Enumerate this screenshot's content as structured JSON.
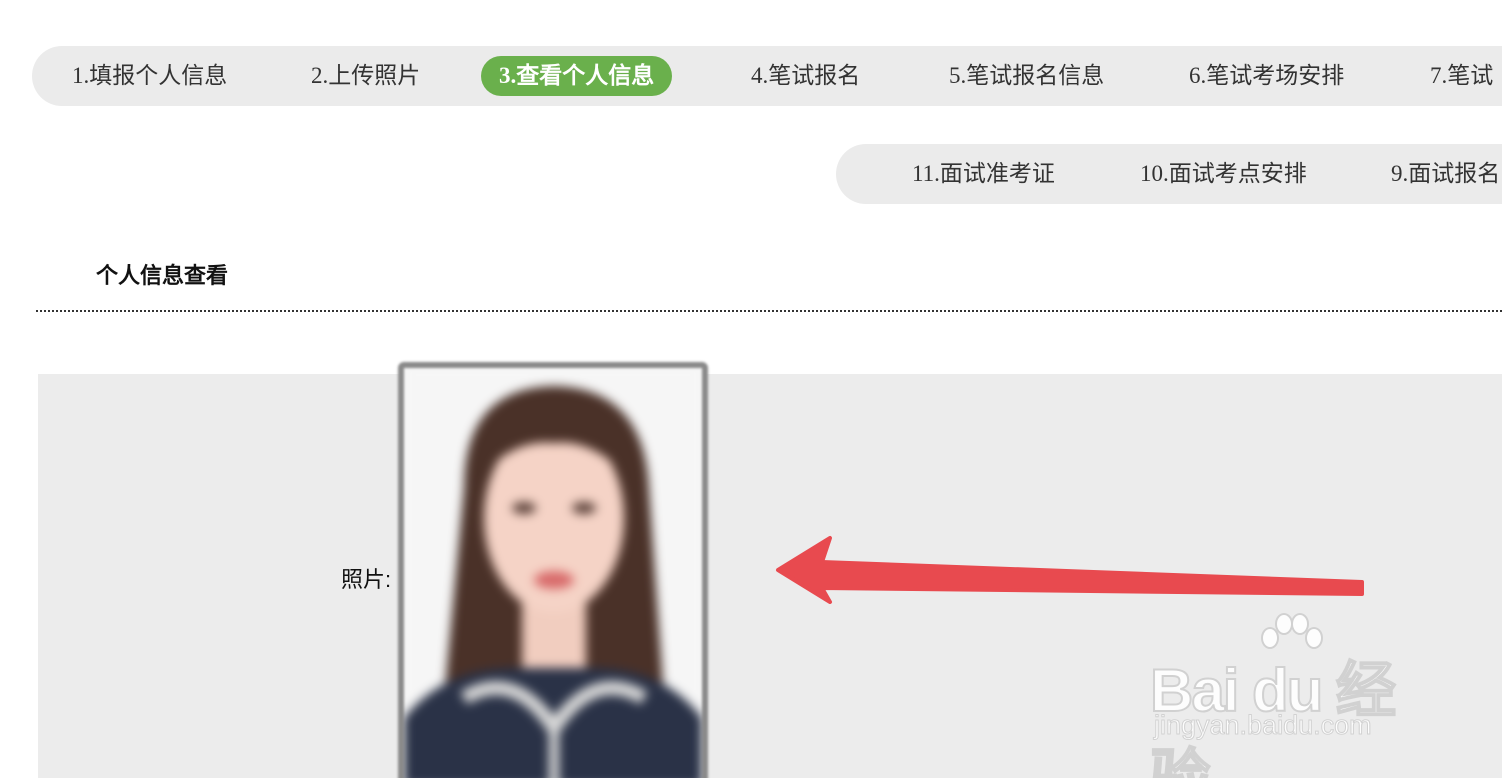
{
  "steps_row1": [
    {
      "label": "1.填报个人信息",
      "active": false
    },
    {
      "label": "2.上传照片",
      "active": false
    },
    {
      "label": "3.查看个人信息",
      "active": true
    },
    {
      "label": "4.笔试报名",
      "active": false
    },
    {
      "label": "5.笔试报名信息",
      "active": false
    },
    {
      "label": "6.笔试考场安排",
      "active": false
    },
    {
      "label": "7.笔试",
      "active": false
    }
  ],
  "steps_row2": [
    {
      "label": "11.面试准考证",
      "active": false
    },
    {
      "label": "10.面试考点安排",
      "active": false
    },
    {
      "label": "9.面试报名",
      "active": false
    }
  ],
  "section": {
    "title": "个人信息查看"
  },
  "info": {
    "photo_label": "照片:"
  },
  "watermark": {
    "logo_text": "Bai du 经验",
    "url": "jingyan.baidu.com"
  },
  "colors": {
    "active_step": "#6ab04c",
    "arrow": "#e84a4f",
    "panel_bg": "#ececec",
    "bar_bg": "#ebebeb"
  }
}
